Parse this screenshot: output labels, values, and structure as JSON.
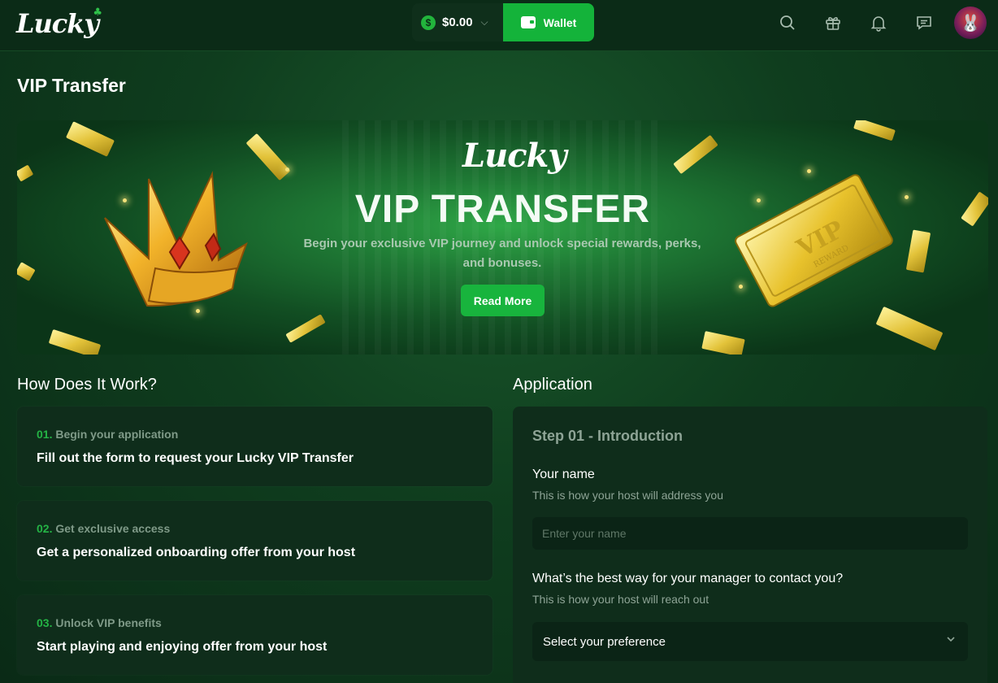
{
  "header": {
    "logo": "Lucky",
    "balance": "$0.00",
    "currency_symbol": "$",
    "wallet_label": "Wallet",
    "icons": [
      "search-icon",
      "gift-icon",
      "bell-icon",
      "chat-icon",
      "avatar"
    ]
  },
  "page": {
    "title": "VIP Transfer"
  },
  "banner": {
    "logo": "Lucky",
    "title": "VIP TRANSFER",
    "subtitle": "Begin your exclusive VIP journey and unlock special rewards, perks, and bonuses.",
    "button": "Read More",
    "ticket_text": "VIP",
    "ticket_sub": "REWARD"
  },
  "how": {
    "title": "How Does It Work?",
    "steps": [
      {
        "num": "01.",
        "head": "Begin your application",
        "text": "Fill out the form to request your Lucky VIP Transfer"
      },
      {
        "num": "02.",
        "head": "Get exclusive access",
        "text": "Get a personalized onboarding offer from your host"
      },
      {
        "num": "03.",
        "head": "Unlock VIP benefits",
        "text": "Start playing and enjoying offer from your host"
      }
    ]
  },
  "application": {
    "title": "Application",
    "step": "Step 01 - Introduction",
    "name_label": "Your name",
    "name_help": "This is how your host will address you",
    "name_placeholder": "Enter your name",
    "contact_label": "What’s the best way for your manager to contact you?",
    "contact_help": "This is how your host will reach out",
    "contact_value": "Select your preference"
  },
  "colors": {
    "accent": "#14b33a",
    "bg": "#0b2b17",
    "card": "#0f2d1b"
  }
}
